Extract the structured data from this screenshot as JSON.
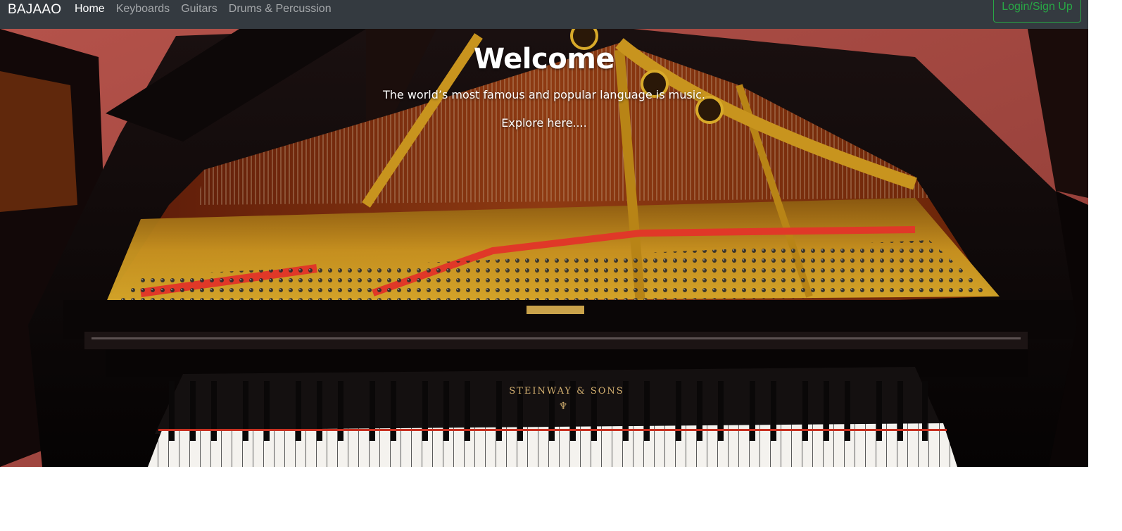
{
  "navbar": {
    "brand": "BAJAAO",
    "links": [
      {
        "label": "Home",
        "active": true
      },
      {
        "label": "Keyboards",
        "active": false
      },
      {
        "label": "Guitars",
        "active": false
      },
      {
        "label": "Drums & Percussion",
        "active": false
      }
    ],
    "login_label": "Login/Sign Up"
  },
  "hero": {
    "title": "Welcome",
    "tagline": "The world’s most famous and popular language is music.",
    "explore_label": "Explore here....",
    "image_subject": "grand-piano-photo",
    "fallboard_text": "STEINWAY & SONS"
  },
  "colors": {
    "navbar_bg": "#343a40",
    "login_accent": "#28a745",
    "nav_inactive": "rgba(255,255,255,0.55)",
    "nav_active": "#ffffff"
  }
}
